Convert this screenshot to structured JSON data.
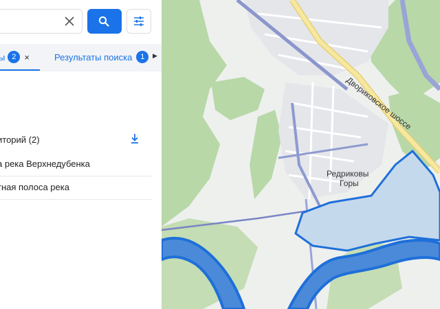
{
  "search": {
    "clear_icon": "close-icon",
    "search_icon": "search-icon",
    "filter_icon": "sliders-icon",
    "accent_color": "#1a73e8"
  },
  "tabs": {
    "active": {
      "label": "ы",
      "count": "2",
      "close": "×"
    },
    "results": {
      "label": "Результаты поиска",
      "count": "1"
    },
    "next": "▶"
  },
  "section": {
    "title": "иторий (2)",
    "download_icon": "download-icon"
  },
  "items": [
    {
      "label": "а река Верхнедубенка"
    },
    {
      "label": "тная полоса река"
    }
  ],
  "map": {
    "labels": {
      "road": "Двориковское шоссе",
      "village_line1": "Редриковы",
      "village_line2": "Горы"
    },
    "highlight_color": "#1e6fd9"
  }
}
